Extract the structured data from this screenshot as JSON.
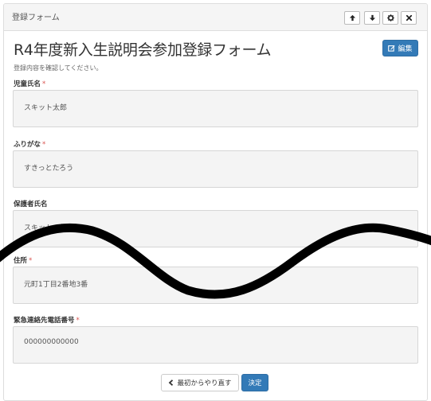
{
  "panel": {
    "title": "登録フォーム"
  },
  "form": {
    "title": "R4年度新入生説明会参加登録フォーム",
    "edit_label": "編集",
    "description": "登録内容を確認してください。"
  },
  "fields": [
    {
      "label": "児童氏名",
      "required": true,
      "value": "スキット太郎"
    },
    {
      "label": "ふりがな",
      "required": true,
      "value": "すきっとたろう"
    },
    {
      "label": "保護者氏名",
      "required": false,
      "value": "スキット一郎"
    },
    {
      "label": "住所",
      "required": true,
      "value": "元町1丁目2番地3番"
    },
    {
      "label": "緊急連絡先電話番号",
      "required": true,
      "value": "000000000000"
    }
  ],
  "required_mark": "*",
  "actions": {
    "back_label": "最初からやり直す",
    "submit_label": "決定"
  },
  "colors": {
    "primary": "#337ab7",
    "required": "#d9534f",
    "field_bg": "#f4f4f4"
  },
  "icons": {
    "header": [
      "arrow-up-icon",
      "arrow-down-icon",
      "gear-icon",
      "close-icon"
    ],
    "edit": "edit-icon",
    "back": "chevron-left-icon"
  }
}
